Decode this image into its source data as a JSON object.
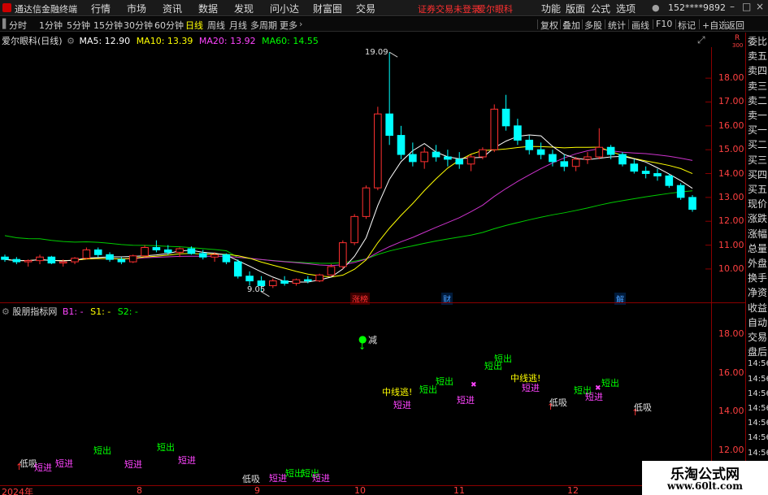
{
  "app": {
    "title": "通达信金融终端",
    "menu": [
      "行情",
      "市场",
      "资讯",
      "数据",
      "发现",
      "问小达",
      "财富圈",
      "交易"
    ],
    "notice": "证券交易未登录",
    "stock_name": "爱尔眼科",
    "right_menu": [
      "功能",
      "版面",
      "公式",
      "选项"
    ],
    "account": "152****9892"
  },
  "toolbar": {
    "periods": [
      "分时",
      "1分钟",
      "5分钟",
      "15分钟",
      "30分钟",
      "60分钟",
      "日线",
      "周线",
      "月线",
      "多周期",
      "更多"
    ],
    "selected": "日线",
    "right_buttons": [
      "复权",
      "叠加",
      "多股",
      "统计",
      "画线",
      "F10",
      "+自选",
      "返回"
    ]
  },
  "main_chart": {
    "header_name": "爱尔眼科(日线)",
    "ma5": "MA5: 12.90",
    "ma10": "MA10: 13.39",
    "ma20": "MA20: 13.92",
    "ma60": "MA60: 14.55",
    "high_label": "19.09",
    "low_label": "9.05",
    "events": [
      "涨榜",
      "财",
      "解"
    ]
  },
  "indicator": {
    "name": "股朋指标网",
    "b1": "B1: -",
    "s1": "S1: -",
    "s2": "S2: -"
  },
  "signals": {
    "jianjin": "减",
    "zhongxian": "中线逃!",
    "duanchu": "短出",
    "duanjin": "短进",
    "dixi": "低吸",
    "zhangxian": "中线逃!"
  },
  "dates": [
    "2024年",
    "8",
    "9",
    "10",
    "11",
    "12"
  ],
  "side_panel": [
    "委比",
    "卖五",
    "卖四",
    "卖三",
    "卖二",
    "卖一",
    "买一",
    "买二",
    "买三",
    "买四",
    "买五",
    "现价",
    "涨跌",
    "涨幅",
    "总量",
    "外盘",
    "换手",
    "净资",
    "收益",
    "自动",
    "交易",
    "盘后",
    "14:56",
    "14:56",
    "14:56",
    "14:56",
    "14:56",
    "14:56",
    "14:56",
    "14:56",
    "14:56"
  ],
  "watermark": {
    "line1": "乐淘公式网",
    "line2": "www.60lt.com"
  },
  "chart_data": {
    "type": "candlestick",
    "main_axis": {
      "ticks": [
        "18.00",
        "17.00",
        "16.00",
        "15.00",
        "14.00",
        "13.00",
        "12.00",
        "11.00",
        "10.00"
      ]
    },
    "indicator_axis": {
      "ticks": [
        "18.00",
        "16.00",
        "14.00",
        "12.00"
      ]
    },
    "candles": [
      [
        10.5,
        10.6,
        10.3,
        10.4
      ],
      [
        10.4,
        10.5,
        10.2,
        10.3
      ],
      [
        10.3,
        10.4,
        10.1,
        10.35
      ],
      [
        10.35,
        10.6,
        10.2,
        10.5
      ],
      [
        10.5,
        10.55,
        10.2,
        10.25
      ],
      [
        10.25,
        10.4,
        10.1,
        10.3
      ],
      [
        10.3,
        10.5,
        10.2,
        10.45
      ],
      [
        10.45,
        10.9,
        10.4,
        10.8
      ],
      [
        10.8,
        10.9,
        10.5,
        10.6
      ],
      [
        10.6,
        10.7,
        10.3,
        10.4
      ],
      [
        10.4,
        10.5,
        10.2,
        10.3
      ],
      [
        10.3,
        10.6,
        10.25,
        10.55
      ],
      [
        10.55,
        11.0,
        10.5,
        10.9
      ],
      [
        10.9,
        11.2,
        10.7,
        10.8
      ],
      [
        10.8,
        11.0,
        10.6,
        10.7
      ],
      [
        10.7,
        10.9,
        10.5,
        10.85
      ],
      [
        10.85,
        10.95,
        10.6,
        10.65
      ],
      [
        10.65,
        10.8,
        10.4,
        10.5
      ],
      [
        10.5,
        10.7,
        10.3,
        10.6
      ],
      [
        10.6,
        10.65,
        10.2,
        10.3
      ],
      [
        10.3,
        10.4,
        9.6,
        9.7
      ],
      [
        9.7,
        9.9,
        9.3,
        9.5
      ],
      [
        9.5,
        9.7,
        9.05,
        9.3
      ],
      [
        9.3,
        9.6,
        9.2,
        9.5
      ],
      [
        9.5,
        9.7,
        9.3,
        9.4
      ],
      [
        9.4,
        9.6,
        9.3,
        9.55
      ],
      [
        9.55,
        9.7,
        9.4,
        9.5
      ],
      [
        9.5,
        9.8,
        9.45,
        9.75
      ],
      [
        9.75,
        10.2,
        9.7,
        10.1
      ],
      [
        10.1,
        11.2,
        10.0,
        11.1
      ],
      [
        11.1,
        12.3,
        11.0,
        12.2
      ],
      [
        12.2,
        13.5,
        12.1,
        13.4
      ],
      [
        13.4,
        16.8,
        13.3,
        16.5
      ],
      [
        16.5,
        19.09,
        15.2,
        15.6
      ],
      [
        15.6,
        16.0,
        14.6,
        14.8
      ],
      [
        14.8,
        15.3,
        14.3,
        14.5
      ],
      [
        14.5,
        15.1,
        14.2,
        14.9
      ],
      [
        14.9,
        15.2,
        14.5,
        14.7
      ],
      [
        14.7,
        15.0,
        14.3,
        14.6
      ],
      [
        14.6,
        14.9,
        14.2,
        14.4
      ],
      [
        14.4,
        14.8,
        14.1,
        14.7
      ],
      [
        14.7,
        15.1,
        14.6,
        15.0
      ],
      [
        15.0,
        16.9,
        14.9,
        16.7
      ],
      [
        16.7,
        17.3,
        15.8,
        16.0
      ],
      [
        16.0,
        16.3,
        15.2,
        15.4
      ],
      [
        15.4,
        15.6,
        14.8,
        15.0
      ],
      [
        15.0,
        15.3,
        14.6,
        14.8
      ],
      [
        14.8,
        15.0,
        14.3,
        14.5
      ],
      [
        14.5,
        14.8,
        14.1,
        14.3
      ],
      [
        14.3,
        14.7,
        14.1,
        14.6
      ],
      [
        14.6,
        14.9,
        14.4,
        14.7
      ],
      [
        14.7,
        15.9,
        14.6,
        15.1
      ],
      [
        15.1,
        15.2,
        14.6,
        14.8
      ],
      [
        14.8,
        14.9,
        14.3,
        14.4
      ],
      [
        14.4,
        14.6,
        14.0,
        14.1
      ],
      [
        14.1,
        14.3,
        13.8,
        14.0
      ],
      [
        14.0,
        14.2,
        13.7,
        13.9
      ],
      [
        13.9,
        14.0,
        13.4,
        13.5
      ],
      [
        13.5,
        13.6,
        12.9,
        13.0
      ],
      [
        13.0,
        13.1,
        12.4,
        12.5
      ]
    ]
  }
}
